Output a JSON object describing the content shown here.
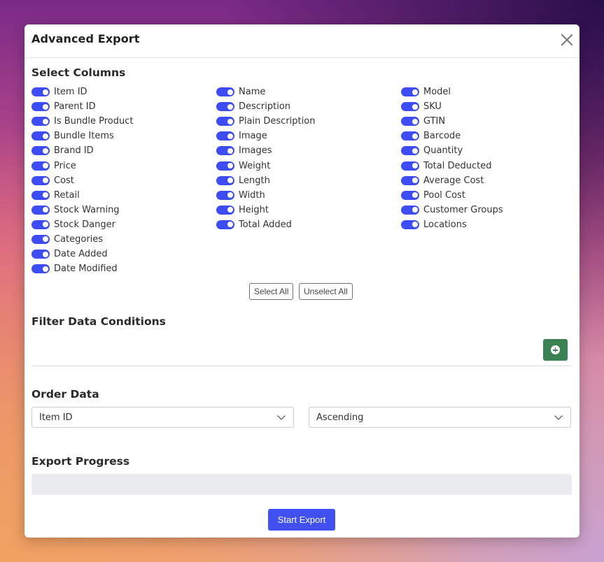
{
  "modal": {
    "title": "Advanced Export"
  },
  "select_columns": {
    "heading": "Select Columns",
    "column_1": [
      "Item ID",
      "Parent ID",
      "Is Bundle Product",
      "Bundle Items",
      "Brand ID",
      "Price",
      "Cost",
      "Retail",
      "Stock Warning",
      "Stock Danger",
      "Categories",
      "Date Added",
      "Date Modified"
    ],
    "column_2": [
      "Name",
      "Description",
      "Plain Description",
      "Image",
      "Images",
      "Weight",
      "Length",
      "Width",
      "Height",
      "Total Added"
    ],
    "column_3": [
      "Model",
      "SKU",
      "GTIN",
      "Barcode",
      "Quantity",
      "Total Deducted",
      "Average Cost",
      "Pool Cost",
      "Customer Groups",
      "Locations"
    ],
    "all_checked": true,
    "select_all_label": "Select All",
    "unselect_all_label": "Unselect All"
  },
  "filter": {
    "heading": "Filter Data Conditions",
    "add_icon": "plus-circle-icon"
  },
  "order": {
    "heading": "Order Data",
    "field_value": "Item ID",
    "direction_value": "Ascending"
  },
  "progress": {
    "heading": "Export Progress",
    "percent": 0
  },
  "start_label": "Start Export",
  "colors": {
    "accent": "#4150f0",
    "add_button": "#3a8153"
  }
}
